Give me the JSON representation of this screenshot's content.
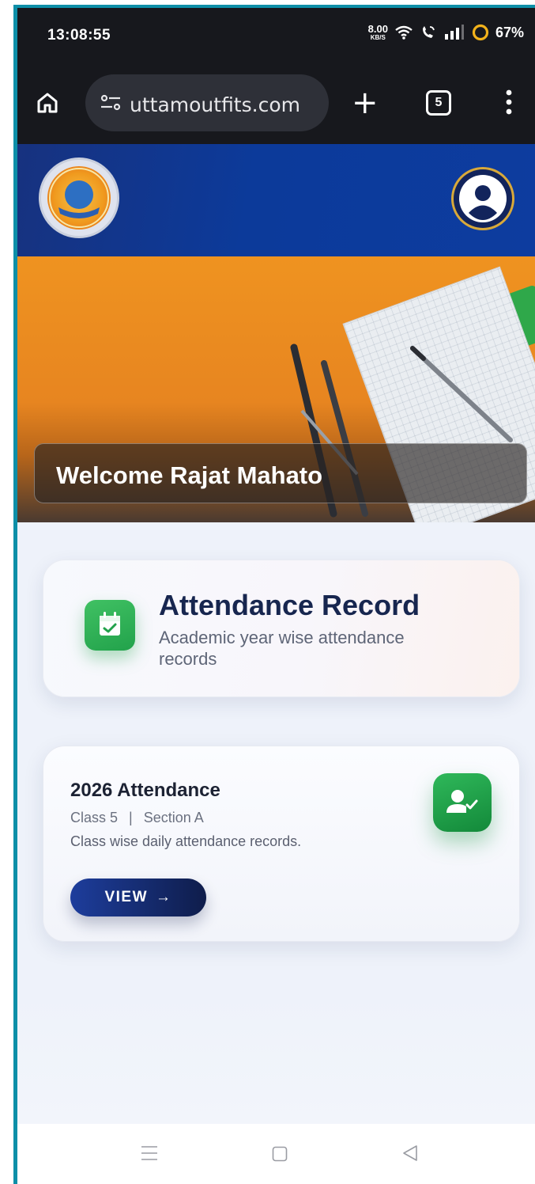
{
  "status_bar": {
    "time": "13:08:55",
    "speed_value": "8.00",
    "speed_unit": "KB/S",
    "battery": "67%"
  },
  "browser": {
    "url": "uttamoutfits.com",
    "tab_count": "5"
  },
  "hero": {
    "welcome": "Welcome Rajat Mahato"
  },
  "attendance_card": {
    "title": "Attendance Record",
    "subtitle": "Academic year wise attendance records"
  },
  "year_card": {
    "title": "2026 Attendance",
    "class_label": "Class 5",
    "separator": "|",
    "section_label": "Section A",
    "description": "Class wise daily attendance records.",
    "button_label": "VIEW",
    "button_arrow": "→"
  },
  "colors": {
    "accent_border": "#0d8fa8",
    "header_blue": "#0c3a9a",
    "green": "#22a24b",
    "hero_orange": "#ef9320"
  },
  "icons": [
    "home-icon",
    "site-settings-icon",
    "new-tab-icon",
    "tab-switcher-icon",
    "more-icon",
    "school-logo",
    "profile-icon",
    "calendar-check-icon",
    "user-check-icon",
    "nav-menu-icon",
    "nav-home-icon",
    "nav-back-icon"
  ]
}
